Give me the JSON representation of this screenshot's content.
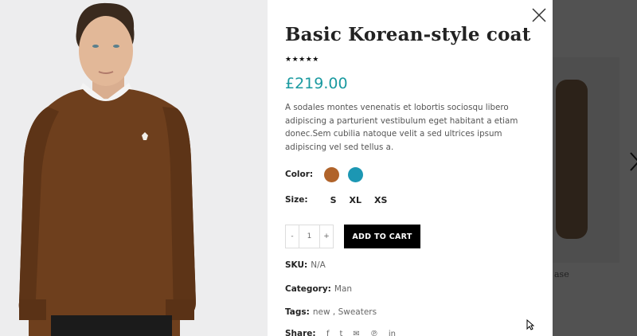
{
  "background": {
    "card_text": "ase"
  },
  "product": {
    "title": "Basic Korean-style coat",
    "rating_stars": "★★★★★",
    "rating_value": 5,
    "price": "£219.00",
    "description": "A sodales montes venenatis et lobortis sociosqu libero adipiscing a parturient vestibulum eget habitant a etiam donec.Sem cubilia natoque velit a sed ultrices ipsum adipiscing vel sed tellus a.",
    "color_label": "Color:",
    "colors": [
      "#b0632a",
      "#1c97b3"
    ],
    "size_label": "Size:",
    "sizes": [
      "S",
      "XL",
      "XS"
    ],
    "qty": {
      "minus": "-",
      "value": "1",
      "plus": "+"
    },
    "add_to_cart": "ADD TO CART",
    "sku_label": "SKU:",
    "sku_value": "N/A",
    "category_label": "Category:",
    "category_value": "Man",
    "tags_label": "Tags:",
    "tags_value": "new ,  Sweaters",
    "share_label": "Share:",
    "share_icons": [
      "facebook-icon",
      "twitter-icon",
      "email-icon",
      "pinterest-icon",
      "linkedin-icon"
    ]
  },
  "colors": {
    "accent": "#1a9aa0",
    "button_bg": "#000000"
  }
}
